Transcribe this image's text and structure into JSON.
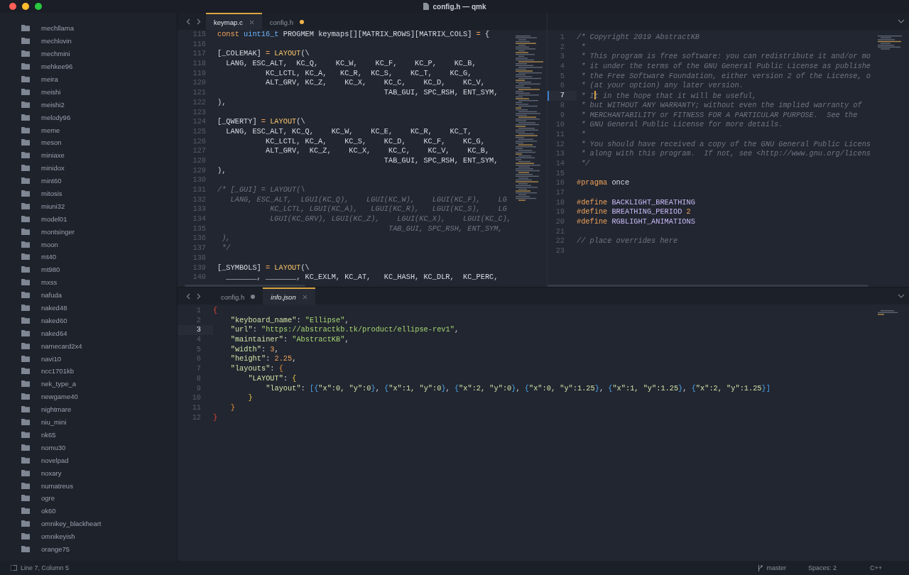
{
  "window": {
    "title": "config.h — qmk"
  },
  "sidebar": {
    "items": [
      {
        "label": "mechllama"
      },
      {
        "label": "mechlovin"
      },
      {
        "label": "mechmini"
      },
      {
        "label": "mehkee96"
      },
      {
        "label": "meira"
      },
      {
        "label": "meishi"
      },
      {
        "label": "meishi2"
      },
      {
        "label": "melody96"
      },
      {
        "label": "meme"
      },
      {
        "label": "meson"
      },
      {
        "label": "miniaxe"
      },
      {
        "label": "minidox"
      },
      {
        "label": "mint60"
      },
      {
        "label": "mitosis"
      },
      {
        "label": "miuni32"
      },
      {
        "label": "model01"
      },
      {
        "label": "montsinger"
      },
      {
        "label": "moon"
      },
      {
        "label": "mt40"
      },
      {
        "label": "mt980"
      },
      {
        "label": "mxss"
      },
      {
        "label": "nafuda"
      },
      {
        "label": "naked48"
      },
      {
        "label": "naked60"
      },
      {
        "label": "naked64"
      },
      {
        "label": "namecard2x4"
      },
      {
        "label": "navi10"
      },
      {
        "label": "ncc1701kb"
      },
      {
        "label": "nek_type_a"
      },
      {
        "label": "newgame40"
      },
      {
        "label": "nightmare"
      },
      {
        "label": "niu_mini"
      },
      {
        "label": "nk65"
      },
      {
        "label": "nomu30"
      },
      {
        "label": "novelpad"
      },
      {
        "label": "noxary"
      },
      {
        "label": "numatreus"
      },
      {
        "label": "ogre"
      },
      {
        "label": "ok60"
      },
      {
        "label": "omnikey_blackheart"
      },
      {
        "label": "omnikeyish"
      },
      {
        "label": "orange75"
      }
    ]
  },
  "editor": {
    "panes": [
      {
        "tabs": [
          {
            "label": "keymap.c",
            "selected": true,
            "modified": false,
            "preview": false
          },
          {
            "label": "config.h",
            "selected": false,
            "modified": true,
            "preview": false
          }
        ],
        "lines": [
          {
            "number": "115",
            "active": false,
            "segments": [
              {
                "text": "const",
                "kind": "keyword"
              },
              {
                "text": " uint16_t",
                "kind": "type"
              },
              {
                "text": " PROGMEM keymaps[][MATRIX_ROWS][MATRIX_COLS] ",
                "kind": "plain"
              },
              {
                "text": "=",
                "kind": "operator"
              },
              {
                "text": " {",
                "kind": "plain"
              }
            ]
          },
          {
            "number": "116",
            "active": false
          },
          {
            "number": "117",
            "active": false,
            "segments": [
              {
                "text": "[_COLEMAK] ",
                "kind": "plain"
              },
              {
                "text": "=",
                "kind": "operator"
              },
              {
                "text": " LAYOUT",
                "kind": "func"
              },
              {
                "text": "(\\",
                "kind": "plain"
              }
            ]
          },
          {
            "number": "118",
            "active": false,
            "segments": [
              {
                "text": "  LANG, ESC_ALT,  KC_Q,    KC_W,    KC_F,    KC_P,    KC_B,",
                "kind": "plain"
              }
            ]
          },
          {
            "number": "119",
            "active": false,
            "segments": [
              {
                "text": "           KC_LCTL, KC_A,   KC_R,  KC_S,    KC_T,    KC_G,",
                "kind": "plain"
              }
            ]
          },
          {
            "number": "120",
            "active": false,
            "segments": [
              {
                "text": "           ALT_GRV, KC_Z,    KC_X,    KC_C,    KC_D,    KC_V,",
                "kind": "plain"
              }
            ]
          },
          {
            "number": "121",
            "active": false,
            "segments": [
              {
                "text": "                                      TAB_GUI, SPC_RSH, ENT_SYM,",
                "kind": "plain"
              }
            ]
          },
          {
            "number": "122",
            "active": false,
            "segments": [
              {
                "text": "),",
                "kind": "plain"
              }
            ]
          },
          {
            "number": "123",
            "active": false
          },
          {
            "number": "124",
            "active": false,
            "segments": [
              {
                "text": "[_QWERTY] ",
                "kind": "plain"
              },
              {
                "text": "=",
                "kind": "operator"
              },
              {
                "text": " LAYOUT",
                "kind": "func"
              },
              {
                "text": "(\\",
                "kind": "plain"
              }
            ]
          },
          {
            "number": "125",
            "active": false,
            "segments": [
              {
                "text": "  LANG, ESC_ALT, KC_Q,    KC_W,    KC_E,    KC_R,    KC_T,",
                "kind": "plain"
              }
            ]
          },
          {
            "number": "126",
            "active": false,
            "segments": [
              {
                "text": "           KC_LCTL, KC_A,    KC_S,    KC_D,    KC_F,    KC_G,",
                "kind": "plain"
              }
            ]
          },
          {
            "number": "127",
            "active": false,
            "segments": [
              {
                "text": "           ALT_GRV,  KC_Z,    KC_X,    KC_C,    KC_V,    KC_B,",
                "kind": "plain"
              }
            ]
          },
          {
            "number": "128",
            "active": false,
            "segments": [
              {
                "text": "                                      TAB_GUI, SPC_RSH, ENT_SYM,",
                "kind": "plain"
              }
            ]
          },
          {
            "number": "129",
            "active": false,
            "segments": [
              {
                "text": "),",
                "kind": "plain"
              }
            ]
          },
          {
            "number": "130",
            "active": false
          },
          {
            "number": "131",
            "active": false,
            "segments": [
              {
                "text": "/* [_GUI] = LAYOUT(\\",
                "kind": "comment"
              }
            ]
          },
          {
            "number": "132",
            "active": false,
            "segments": [
              {
                "text": "   LANG, ESC_ALT,  LGUI(KC_Q),    LGUI(KC_W),    LGUI(KC_F),    LG",
                "kind": "comment"
              }
            ]
          },
          {
            "number": "133",
            "active": false,
            "segments": [
              {
                "text": "            KC_LCTL, LGUI(KC_A),   LGUI(KC_R),   LGUI(KC_S),    LG",
                "kind": "comment"
              }
            ]
          },
          {
            "number": "134",
            "active": false,
            "segments": [
              {
                "text": "            LGUI(KC_GRV), LGUI(KC_Z),    LGUI(KC_X),    LGUI(KC_C),",
                "kind": "comment"
              }
            ]
          },
          {
            "number": "135",
            "active": false,
            "segments": [
              {
                "text": "                                       TAB_GUI, SPC_RSH, ENT_SYM,",
                "kind": "comment"
              }
            ]
          },
          {
            "number": "136",
            "active": false,
            "segments": [
              {
                "text": " ),",
                "kind": "comment"
              }
            ]
          },
          {
            "number": "137",
            "active": false,
            "segments": [
              {
                "text": " */",
                "kind": "comment"
              }
            ]
          },
          {
            "number": "138",
            "active": false
          },
          {
            "number": "139",
            "active": false,
            "segments": [
              {
                "text": "[_SYMBOLS] ",
                "kind": "plain"
              },
              {
                "text": "=",
                "kind": "operator"
              },
              {
                "text": " LAYOUT",
                "kind": "func"
              },
              {
                "text": "(\\",
                "kind": "plain"
              }
            ]
          },
          {
            "number": "140",
            "active": false,
            "segments": [
              {
                "text": "  _______, _______, KC_EXLM, KC_AT,   KC_HASH, KC_DLR,  KC_PERC,",
                "kind": "plain"
              }
            ]
          }
        ]
      },
      {
        "lines": [
          {
            "number": "1",
            "active": false,
            "segments": [
              {
                "text": "/* Copyright 2019 AbstractKB",
                "kind": "comment"
              }
            ]
          },
          {
            "number": "2",
            "active": false,
            "segments": [
              {
                "text": " *",
                "kind": "comment"
              }
            ]
          },
          {
            "number": "3",
            "active": false,
            "segments": [
              {
                "text": " * This program is free software: you can redistribute it and/or mo",
                "kind": "comment"
              }
            ]
          },
          {
            "number": "4",
            "active": false,
            "segments": [
              {
                "text": " * it under the terms of the GNU General Public License as publishe",
                "kind": "comment"
              }
            ]
          },
          {
            "number": "5",
            "active": false,
            "segments": [
              {
                "text": " * the Free Software Foundation, either version 2 of the License, o",
                "kind": "comment"
              }
            ]
          },
          {
            "number": "6",
            "active": false,
            "segments": [
              {
                "text": " * (at your option) any later version.",
                "kind": "comment"
              }
            ]
          },
          {
            "number": "7",
            "active": true,
            "segments": [
              {
                "text": " * I",
                "kind": "comment"
              },
              {
                "kind": "cursor"
              },
              {
                "text": "t in the hope that it will be useful,",
                "kind": "comment"
              }
            ]
          },
          {
            "number": "8",
            "active": false,
            "segments": [
              {
                "text": " * but WITHOUT ANY WARRANTY; without even the implied warranty of",
                "kind": "comment"
              }
            ]
          },
          {
            "number": "9",
            "active": false,
            "segments": [
              {
                "text": " * MERCHANTABILITY or FITNESS FOR A PARTICULAR PURPOSE.  See the",
                "kind": "comment"
              }
            ]
          },
          {
            "number": "10",
            "active": false,
            "segments": [
              {
                "text": " * GNU General Public License for more details.",
                "kind": "comment"
              }
            ]
          },
          {
            "number": "11",
            "active": false,
            "segments": [
              {
                "text": " *",
                "kind": "comment"
              }
            ]
          },
          {
            "number": "12",
            "active": false,
            "segments": [
              {
                "text": " * You should have received a copy of the GNU General Public Licens",
                "kind": "comment"
              }
            ]
          },
          {
            "number": "13",
            "active": false,
            "segments": [
              {
                "text": " * along with this program.  If not, see <http://www.gnu.org/licens",
                "kind": "comment"
              }
            ]
          },
          {
            "number": "14",
            "active": false,
            "segments": [
              {
                "text": " */",
                "kind": "comment"
              }
            ]
          },
          {
            "number": "15",
            "active": false
          },
          {
            "number": "16",
            "active": false,
            "segments": [
              {
                "text": "#pragma",
                "kind": "keyword"
              },
              {
                "text": " once",
                "kind": "plain"
              }
            ]
          },
          {
            "number": "17",
            "active": false
          },
          {
            "number": "18",
            "active": false,
            "segments": [
              {
                "text": "#define",
                "kind": "keyword"
              },
              {
                "text": " BACKLIGHT_BREATHING",
                "kind": "macro"
              }
            ]
          },
          {
            "number": "19",
            "active": false,
            "segments": [
              {
                "text": "#define",
                "kind": "keyword"
              },
              {
                "text": " BREATHING_PERIOD",
                "kind": "macro"
              },
              {
                "text": " 2",
                "kind": "number"
              }
            ]
          },
          {
            "number": "20",
            "active": false,
            "segments": [
              {
                "text": "#define",
                "kind": "keyword"
              },
              {
                "text": " RGBLIGHT_ANIMATIONS",
                "kind": "macro"
              }
            ]
          },
          {
            "number": "21",
            "active": false
          },
          {
            "number": "22",
            "active": false,
            "segments": [
              {
                "text": "// place overrides here",
                "kind": "comment"
              }
            ]
          },
          {
            "number": "23",
            "active": false
          }
        ]
      },
      {
        "tabs": [
          {
            "label": "config.h",
            "selected": false,
            "modified": true,
            "preview": false
          },
          {
            "label": "info.json",
            "selected": true,
            "modified": false,
            "preview": true
          }
        ],
        "lines": [
          {
            "number": "1",
            "active": false,
            "segments": [
              {
                "text": "{",
                "kind": "bracket1"
              }
            ]
          },
          {
            "number": "2",
            "active": false,
            "segments": [
              {
                "text": "    \"keyboard_name\"",
                "kind": "key"
              },
              {
                "text": ": ",
                "kind": "plain"
              },
              {
                "text": "\"Ellipse\"",
                "kind": "string"
              },
              {
                "text": ",",
                "kind": "plain"
              }
            ]
          },
          {
            "number": "3",
            "active": true,
            "segments": [
              {
                "text": "    \"url\"",
                "kind": "key"
              },
              {
                "text": ": ",
                "kind": "plain"
              },
              {
                "text": "\"https://abstractkb.tk/product/ellipse-rev1\"",
                "kind": "string"
              },
              {
                "text": ",",
                "kind": "plain"
              }
            ]
          },
          {
            "number": "4",
            "active": false,
            "segments": [
              {
                "text": "    \"maintainer\"",
                "kind": "key"
              },
              {
                "text": ": ",
                "kind": "plain"
              },
              {
                "text": "\"AbstractKB\"",
                "kind": "string"
              },
              {
                "text": ",",
                "kind": "plain"
              }
            ]
          },
          {
            "number": "5",
            "active": false,
            "segments": [
              {
                "text": "    \"width\"",
                "kind": "key"
              },
              {
                "text": ": ",
                "kind": "plain"
              },
              {
                "text": "3",
                "kind": "number"
              },
              {
                "text": ",",
                "kind": "plain"
              }
            ]
          },
          {
            "number": "6",
            "active": false,
            "segments": [
              {
                "text": "    \"height\"",
                "kind": "key"
              },
              {
                "text": ": ",
                "kind": "plain"
              },
              {
                "text": "2.25",
                "kind": "number"
              },
              {
                "text": ",",
                "kind": "plain"
              }
            ]
          },
          {
            "number": "7",
            "active": false,
            "segments": [
              {
                "text": "    \"layouts\"",
                "kind": "key"
              },
              {
                "text": ": ",
                "kind": "plain"
              },
              {
                "text": "{",
                "kind": "bracket2"
              }
            ]
          },
          {
            "number": "8",
            "active": false,
            "segments": [
              {
                "text": "        \"LAYOUT\"",
                "kind": "key"
              },
              {
                "text": ": ",
                "kind": "plain"
              },
              {
                "text": "{",
                "kind": "bracket3"
              }
            ]
          },
          {
            "number": "9",
            "active": false,
            "segments": [
              {
                "text": "            \"layout\"",
                "kind": "key"
              },
              {
                "text": ": ",
                "kind": "plain"
              },
              {
                "text": "[",
                "kind": "bracket4"
              },
              {
                "text": "{",
                "kind": "bracket4"
              },
              {
                "text": "\"x\":0, \"y\":0",
                "kind": "key"
              },
              {
                "text": "}",
                "kind": "bracket4"
              },
              {
                "text": ", ",
                "kind": "plain"
              },
              {
                "text": "{",
                "kind": "bracket4"
              },
              {
                "text": "\"x\":1, \"y\":0",
                "kind": "key"
              },
              {
                "text": "}",
                "kind": "bracket4"
              },
              {
                "text": ", ",
                "kind": "plain"
              },
              {
                "text": "{",
                "kind": "bracket4"
              },
              {
                "text": "\"x\":2, \"y\":0",
                "kind": "key"
              },
              {
                "text": "}",
                "kind": "bracket4"
              },
              {
                "text": ", ",
                "kind": "plain"
              },
              {
                "text": "{",
                "kind": "bracket4"
              },
              {
                "text": "\"x\":0, \"y\":1.25",
                "kind": "key"
              },
              {
                "text": "}",
                "kind": "bracket4"
              },
              {
                "text": ", ",
                "kind": "plain"
              },
              {
                "text": "{",
                "kind": "bracket4"
              },
              {
                "text": "\"x\":1, \"y\":1.25",
                "kind": "key"
              },
              {
                "text": "}",
                "kind": "bracket4"
              },
              {
                "text": ", ",
                "kind": "plain"
              },
              {
                "text": "{",
                "kind": "bracket4"
              },
              {
                "text": "\"x\":2, \"y\":1.25",
                "kind": "key"
              },
              {
                "text": "}",
                "kind": "bracket4"
              },
              {
                "text": "]",
                "kind": "bracket4"
              }
            ]
          },
          {
            "number": "10",
            "active": false,
            "segments": [
              {
                "text": "        }",
                "kind": "bracket3"
              }
            ]
          },
          {
            "number": "11",
            "active": false,
            "segments": [
              {
                "text": "    }",
                "kind": "bracket2"
              }
            ]
          },
          {
            "number": "12",
            "active": false,
            "segments": [
              {
                "text": "}",
                "kind": "bracket1"
              }
            ]
          }
        ]
      }
    ]
  },
  "status_bar": {
    "position": "Line 7, Column 5",
    "branch": "master",
    "indentation": "Spaces: 2",
    "syntax": "C++"
  }
}
